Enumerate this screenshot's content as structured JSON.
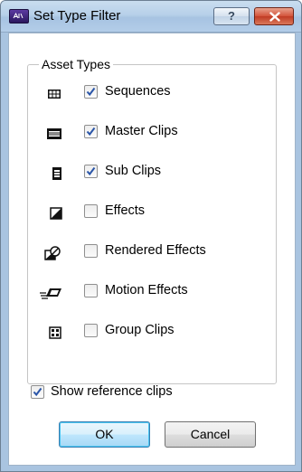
{
  "window": {
    "title": "Set Type Filter",
    "help_label": "?",
    "app_icon": "avid-app-icon",
    "close_icon": "close-icon"
  },
  "asset_types": {
    "label": "Asset Types",
    "items": [
      {
        "label": "Sequences",
        "checked": true,
        "icon": "sequence-icon"
      },
      {
        "label": "Master Clips",
        "checked": true,
        "icon": "master-clip-icon"
      },
      {
        "label": "Sub Clips",
        "checked": true,
        "icon": "subclip-icon"
      },
      {
        "label": "Effects",
        "checked": false,
        "icon": "effect-icon"
      },
      {
        "label": "Rendered Effects",
        "checked": false,
        "icon": "rendered-effect-icon"
      },
      {
        "label": "Motion Effects",
        "checked": false,
        "icon": "motion-effect-icon"
      },
      {
        "label": "Group Clips",
        "checked": false,
        "icon": "group-clip-icon"
      }
    ]
  },
  "show_reference": {
    "label": "Show reference clips",
    "checked": true
  },
  "buttons": {
    "ok": "OK",
    "cancel": "Cancel"
  },
  "colors": {
    "accent": "#3c7fb1",
    "checkmark": "#2a55a8",
    "titlebar": "#b7d0e9"
  }
}
